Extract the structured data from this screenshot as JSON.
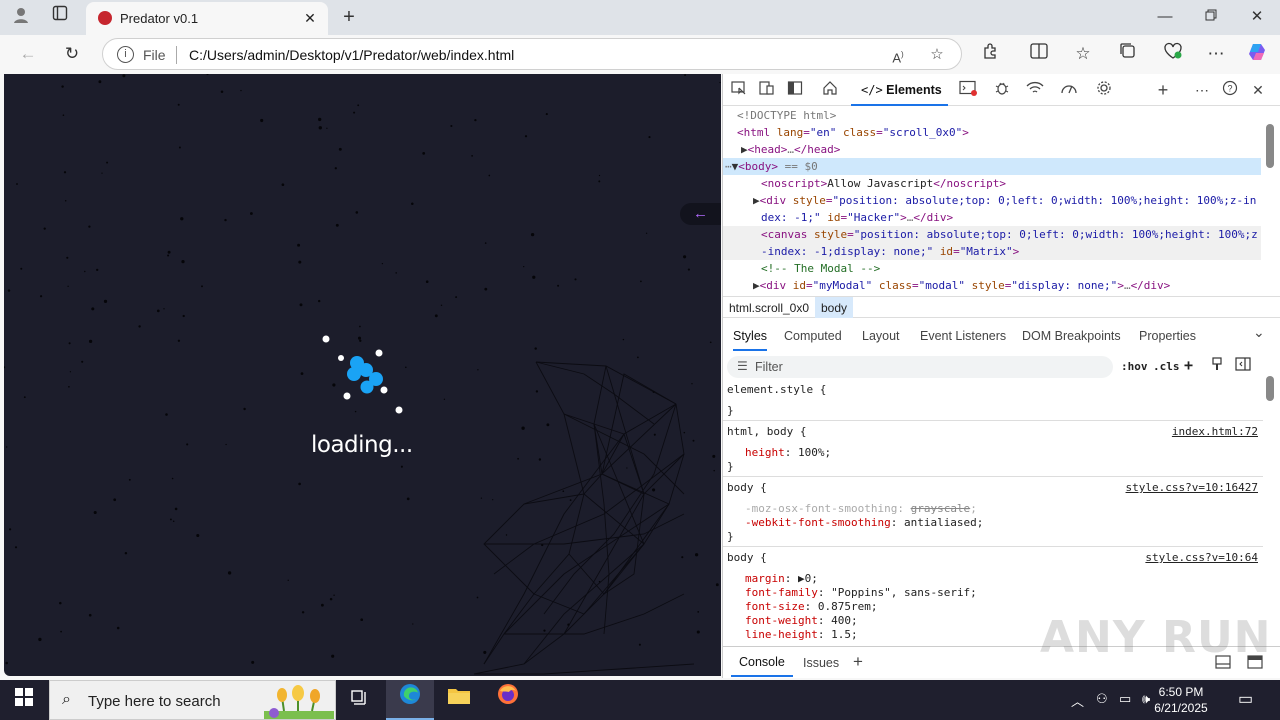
{
  "browser": {
    "tab_title": "Predator v0.1",
    "new_tab_symbol": "+",
    "address_scheme": "File",
    "url": "C:/Users/admin/Desktop/v1/Predator/web/index.html"
  },
  "page": {
    "loading_text": "loading...",
    "back_arrow": "←"
  },
  "devtools": {
    "elements_tab": "Elements",
    "dom_lines": {
      "l1": "<!DOCTYPE html>",
      "l2_tag": "<html",
      "l2_attr1": "lang",
      "l2_val1": "\"en\"",
      "l2_attr2": "class",
      "l2_val2": "\"scroll_0x0\"",
      "l3": "<head>",
      "l3_end": "</head>",
      "l4": "<body>",
      "l4_suffix": "== $0",
      "l5_open": "<noscript>",
      "l5_text": "Allow Javascript",
      "l5_close": "</noscript>",
      "l6a": "position: absolute;top: 0;left: 0;width: 100%;height: 100%;z-in",
      "l6b": "dex: -1;\"",
      "l6_id": "\"Hacker\"",
      "l7a": "position: absolute;top: 0;left: 0;width: 100%;height: 100%;z",
      "l7b": "-index: -1;display: none;\"",
      "l7_id": "\"Matrix\"",
      "l8": "<!-- The Modal -->",
      "l9_id": "\"myModal\"",
      "l9_class": "\"modal\"",
      "l9_style": "\"display: none;\"",
      "ellipsis": "…"
    },
    "breadcrumb": {
      "html": "html.scroll_0x0",
      "body": "body"
    },
    "panel_tabs": {
      "styles": "Styles",
      "computed": "Computed",
      "layout": "Layout",
      "listeners": "Event Listeners",
      "dom_breakpoints": "DOM Breakpoints",
      "properties": "Properties"
    },
    "filter": {
      "placeholder": "Filter",
      "hov": ":hov",
      "cls": ".cls"
    },
    "rules": {
      "r1_selector": "element.style {",
      "close": "}",
      "r2_selector": "html, body {",
      "r2_source": "index.html:72",
      "r2_prop": "height",
      "r2_val": "100%;",
      "r3_selector": "body {",
      "r3_source": "style.css?v=10:16427",
      "r3_prop1": "-moz-osx-font-smoothing",
      "r3_val1": "grayscale",
      "r3_prop2": "-webkit-font-smoothing",
      "r3_val2": "antialiased;",
      "r4_selector": "body {",
      "r4_source": "style.css?v=10:64",
      "r4_margin": "margin",
      "r4_margin_val": "0;",
      "r4_ff": "font-family",
      "r4_ff_val": "\"Poppins\", sans-serif;",
      "r4_fs": "font-size",
      "r4_fs_val": "0.875rem;",
      "r4_fw": "font-weight",
      "r4_fw_val": "400;",
      "r4_lh": "line-height",
      "r4_lh_val": "1.5;"
    },
    "drawer": {
      "console": "Console",
      "issues": "Issues"
    }
  },
  "watermark": "ANY RUN",
  "taskbar": {
    "search_placeholder": "Type here to search",
    "time": "6:50 PM",
    "date": "6/21/2025"
  }
}
